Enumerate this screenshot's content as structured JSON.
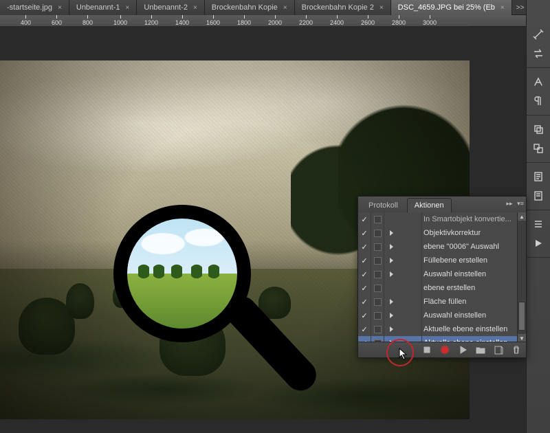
{
  "tabs": [
    {
      "label": "-startseite.jpg"
    },
    {
      "label": "Unbenannt-1"
    },
    {
      "label": "Unbenannt-2"
    },
    {
      "label": "Brockenbahn Kopie"
    },
    {
      "label": "Brockenbahn Kopie 2"
    },
    {
      "label": "DSC_4659.JPG bei 25% (Eb",
      "active": true
    }
  ],
  "tab_nav": ">>",
  "ruler_ticks": [
    400,
    600,
    800,
    1000,
    1200,
    1400,
    1600,
    1800,
    2000,
    2200,
    2400,
    2600,
    2800,
    3000
  ],
  "ruler_tick_spacing_px": 45,
  "ruler_first_tick_x": 30,
  "panel": {
    "tabs": {
      "protokoll": "Protokoll",
      "aktionen": "Aktionen"
    },
    "rows": [
      {
        "checked": true,
        "box": true,
        "expander": false,
        "label": "In Smartobjekt konvertie...",
        "truncated": true,
        "selected": false
      },
      {
        "checked": true,
        "box": true,
        "expander": true,
        "label": "Objektivkorrektur",
        "selected": false
      },
      {
        "checked": true,
        "box": true,
        "expander": true,
        "label": "ebene \"0006\" Auswahl",
        "selected": false
      },
      {
        "checked": true,
        "box": true,
        "expander": true,
        "label": "Füllebene erstellen",
        "selected": false
      },
      {
        "checked": true,
        "box": true,
        "expander": true,
        "label": "Auswahl einstellen",
        "selected": false
      },
      {
        "checked": true,
        "box": true,
        "expander": false,
        "label": "ebene erstellen",
        "selected": false
      },
      {
        "checked": true,
        "box": true,
        "expander": true,
        "label": "Fläche füllen",
        "selected": false
      },
      {
        "checked": true,
        "box": true,
        "expander": true,
        "label": "Auswahl einstellen",
        "selected": false
      },
      {
        "checked": true,
        "box": true,
        "expander": true,
        "label": "Aktuelle ebene einstellen",
        "selected": false
      },
      {
        "checked": true,
        "box": true,
        "expander": true,
        "label": "Aktuelle ebene einstellen",
        "selected": true
      }
    ]
  },
  "sidebar_icons": [
    "refine-icon",
    "swap-icon",
    "char-icon",
    "paragraph-icon",
    "layers-icon",
    "align-icon",
    "notes-icon",
    "symbols-icon",
    "list-icon",
    "play-icon"
  ],
  "footer_icons": [
    "stop-button",
    "record-button",
    "play-button",
    "folder-button",
    "new-action-button",
    "trash-button"
  ]
}
